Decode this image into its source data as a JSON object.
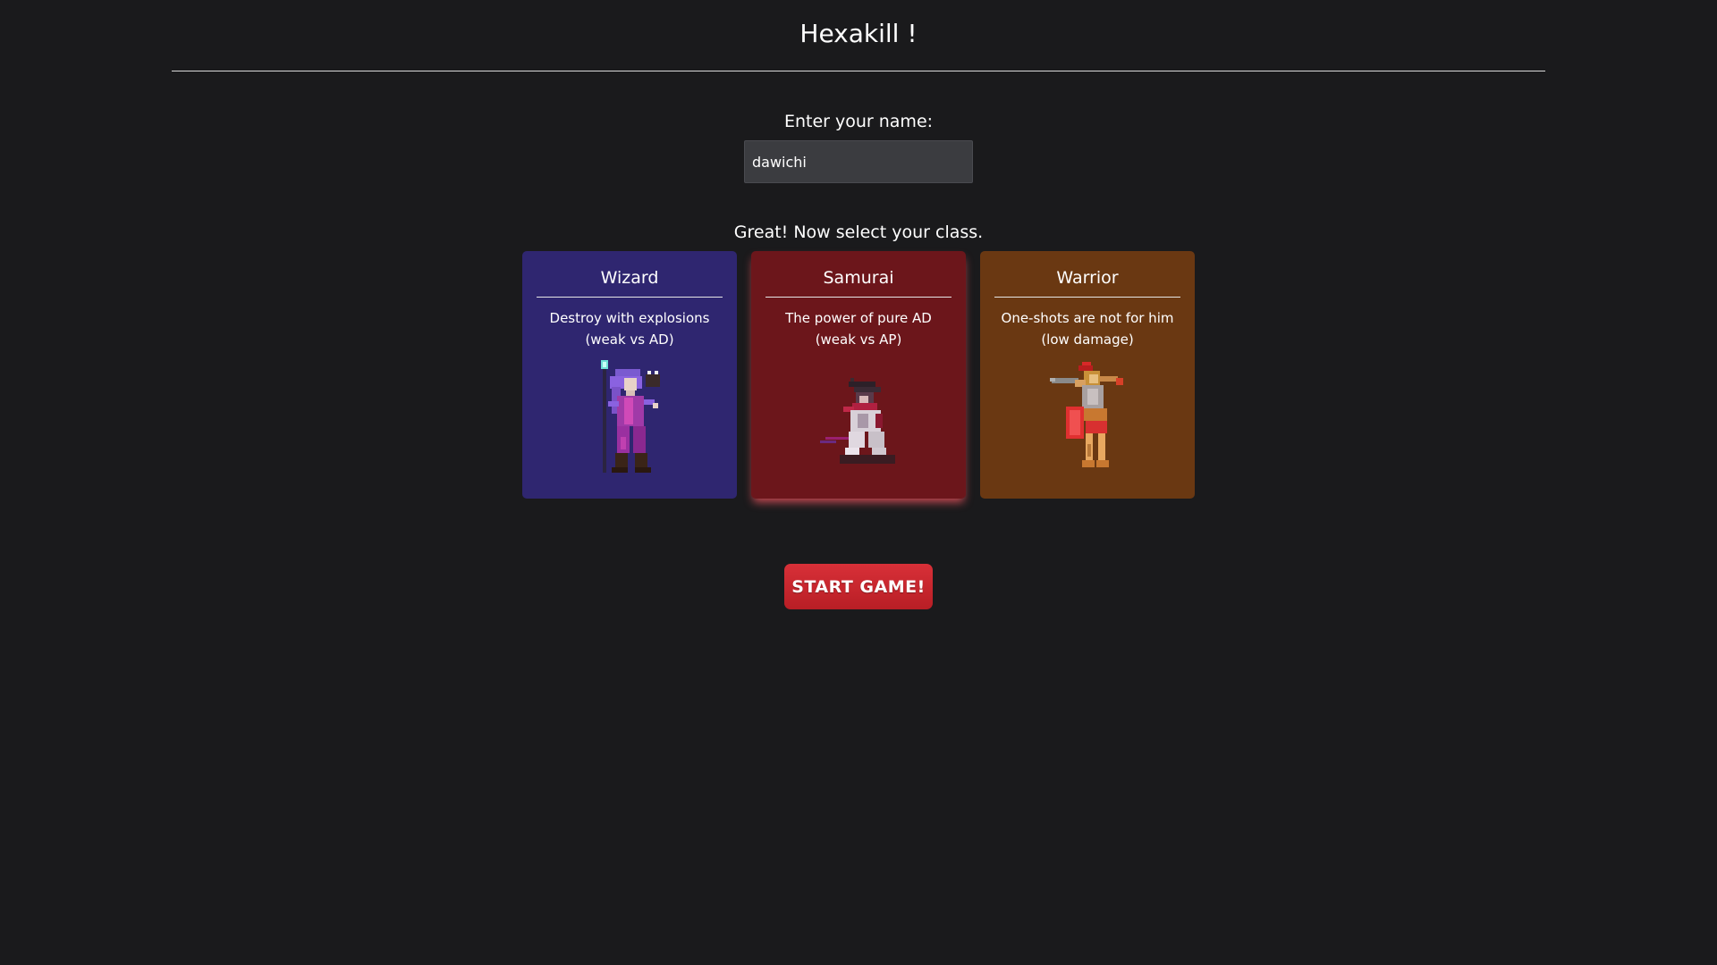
{
  "header": {
    "title": "Hexakill !"
  },
  "name_form": {
    "label": "Enter your name:",
    "value": "dawichi"
  },
  "class_select": {
    "label": "Great! Now select your class.",
    "selected": "Samurai",
    "classes": [
      {
        "name": "Wizard",
        "description_line1": "Destroy with explosions",
        "description_line2": "(weak vs AD)",
        "color": "#2f2670",
        "icon": "wizard-sprite-icon"
      },
      {
        "name": "Samurai",
        "description_line1": "The power of pure AD",
        "description_line2": "(weak vs AP)",
        "color": "#6c161b",
        "icon": "samurai-sprite-icon"
      },
      {
        "name": "Warrior",
        "description_line1": "One-shots are not for him",
        "description_line2": "(low damage)",
        "color": "#6a3812",
        "icon": "warrior-sprite-icon"
      }
    ]
  },
  "actions": {
    "start_label": "START GAME!",
    "start_color": "#c7242a"
  }
}
